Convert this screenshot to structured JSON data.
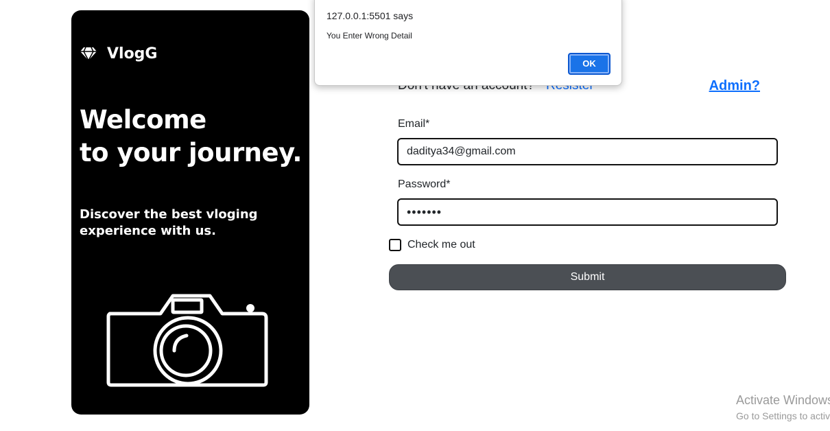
{
  "brand": {
    "name": "VlogG",
    "icon": "diamond-icon"
  },
  "hero": {
    "headline_line1": "Welcome",
    "headline_line2": "to your journey.",
    "subtext_line1": "Discover the best vloging",
    "subtext_line2": "experience with us.",
    "illustration": "camera-icon"
  },
  "account": {
    "prompt": "Don't have an account?",
    "register_label": "Resister",
    "admin_label": "Admin?"
  },
  "form": {
    "email_label": "Email*",
    "email_value": "daditya34@gmail.com",
    "password_label": "Password*",
    "password_value": "•••••••",
    "check_label": "Check me out",
    "check_checked": false,
    "submit_label": "Submit"
  },
  "alert": {
    "origin": "127.0.0.1:5501 says",
    "message": "You Enter Wrong Detail",
    "ok_label": "OK"
  },
  "watermark": {
    "title": "Activate Windows",
    "subtitle": "Go to Settings to activate Windows."
  },
  "colors": {
    "panel": "#000000",
    "link": "#0d6efd",
    "submit": "#4b4f54",
    "alert_button": "#1a73e8"
  }
}
